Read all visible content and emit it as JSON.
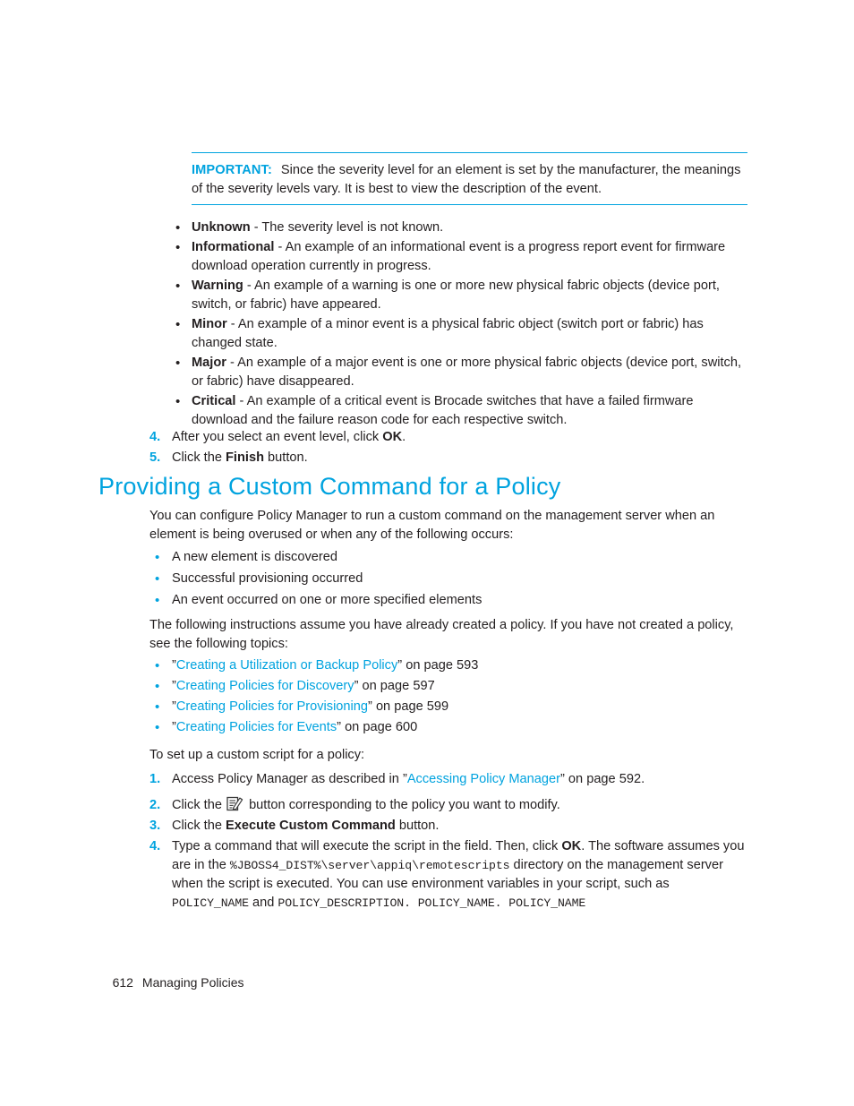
{
  "colors": {
    "accent": "#00a3df",
    "text": "#231f20",
    "background": "#ffffff"
  },
  "note": {
    "label": "IMPORTANT:",
    "text": "Since the severity level for an element is set by the manufacturer, the meanings of the severity levels vary. It is best to view the description of the event."
  },
  "severity_list": [
    {
      "term": "Unknown",
      "desc": " - The severity level is not known."
    },
    {
      "term": "Informational",
      "desc": " - An example of an informational event is a progress report event for firmware download operation currently in progress."
    },
    {
      "term": "Warning",
      "desc": " - An example of a warning is one or more new physical fabric objects (device port, switch, or fabric) have appeared."
    },
    {
      "term": "Minor",
      "desc": " - An example of a minor event is a physical fabric object (switch port or fabric) has changed state."
    },
    {
      "term": "Major",
      "desc": " - An example of a major event is one or more physical fabric objects (device port, switch, or fabric) have disappeared."
    },
    {
      "term": "Critical",
      "desc": " - An example of a critical event is Brocade switches that have a failed firmware download and the failure reason code for each respective switch."
    }
  ],
  "steps_a": [
    {
      "num": "4.",
      "pre": "After you select an event level, click ",
      "bold": "OK",
      "post": "."
    },
    {
      "num": "5.",
      "pre": "Click the ",
      "bold": "Finish",
      "post": " button."
    }
  ],
  "heading": "Providing a Custom Command for a Policy",
  "intro_paragraph": "You can configure Policy Manager to run a custom command on the management server when an element is being overused or when any of the following occurs:",
  "occurs_list": [
    "A new element is discovered",
    "Successful provisioning occurred",
    "An event occurred on one or more specified elements"
  ],
  "topics_paragraph": "The following instructions assume you have already created a policy. If you have not created a policy, see the following topics:",
  "topics_list": [
    {
      "open_quote": "”",
      "link": "Creating a Utilization or Backup Policy",
      "close_quote": "”",
      "page_ref": " on page 593"
    },
    {
      "open_quote": "”",
      "link": "Creating Policies for Discovery",
      "close_quote": "”",
      "page_ref": " on page 597"
    },
    {
      "open_quote": "”",
      "link": "Creating Policies for Provisioning",
      "close_quote": "”",
      "page_ref": " on page 599"
    },
    {
      "open_quote": "”",
      "link": "Creating Policies for Events",
      "close_quote": "”",
      "page_ref": " on page 600"
    }
  ],
  "setup_paragraph": "To set up a custom script for a policy:",
  "steps_b": {
    "step1": {
      "num": "1.",
      "pre": "Access Policy Manager as described in ",
      "open_quote": "”",
      "link": "Accessing Policy Manager",
      "close_quote": "”",
      "post": " on page 592."
    },
    "step2": {
      "num": "2.",
      "pre": "Click the ",
      "icon": "edit-policy-icon",
      "post": " button corresponding to the policy you want to modify."
    },
    "step3": {
      "num": "3.",
      "pre": "Click the ",
      "bold": "Execute Custom Command",
      "post": " button."
    },
    "step4": {
      "num": "4.",
      "p1": "Type a command that will execute the script in the field. Then, click ",
      "bold1": "OK",
      "p2": ". The software assumes you are in the ",
      "code1": "%JBOSS4_DIST%\\server\\appiq\\remotescripts",
      "p3": " directory on the management server when the script is executed. You can use environment variables in your script, such as ",
      "code2": "POLICY_NAME",
      "p4": " and ",
      "code3": "POLICY_DESCRIPTION. POLICY_NAME. POLICY_NAME"
    }
  },
  "footer": {
    "page_number": "612",
    "chapter_title": "Managing Policies"
  }
}
